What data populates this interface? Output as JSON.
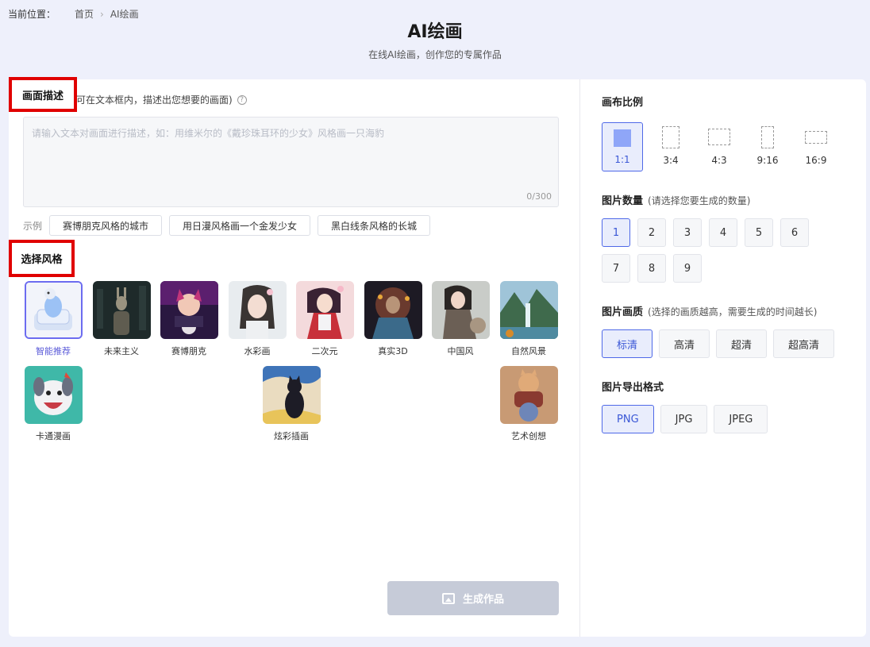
{
  "breadcrumb": {
    "label": "当前位置：",
    "home": "首页",
    "current": "AI绘画"
  },
  "header": {
    "title": "AI绘画",
    "subtitle": "在线AI绘画，创作您的专属作品"
  },
  "description": {
    "title": "画面描述",
    "hint": "可在文本框内，描述出您想要的画面)",
    "help_icon": "?",
    "placeholder": "请输入文本对画面进行描述，如：用维米尔的《戴珍珠耳环的少女》风格画一只海豹",
    "count": "0/300"
  },
  "examples": {
    "label": "示例",
    "items": [
      "赛博朋克风格的城市",
      "用日漫风格画一个金发少女",
      "黑白线条风格的长城"
    ]
  },
  "styles": {
    "title": "选择风格",
    "items": [
      {
        "name": "智能推荐"
      },
      {
        "name": "未来主义"
      },
      {
        "name": "赛博朋克"
      },
      {
        "name": "水彩画"
      },
      {
        "name": "二次元"
      },
      {
        "name": "真实3D"
      },
      {
        "name": "中国风"
      },
      {
        "name": "自然风景"
      },
      {
        "name": "卡通漫画"
      },
      {
        "name": "炫彩插画"
      },
      {
        "name": "艺术创想"
      }
    ]
  },
  "generate": {
    "label": "生成作品"
  },
  "ratio": {
    "title": "画布比例",
    "options": [
      "1:1",
      "3:4",
      "4:3",
      "9:16",
      "16:9"
    ],
    "selected": "1:1"
  },
  "count": {
    "title": "图片数量",
    "sub": "(请选择您要生成的数量)",
    "options": [
      "1",
      "2",
      "3",
      "4",
      "5",
      "6",
      "7",
      "8",
      "9"
    ],
    "selected": "1"
  },
  "quality": {
    "title": "图片画质",
    "sub": "(选择的画质越高，需要生成的时间越长)",
    "options": [
      "标清",
      "高清",
      "超清",
      "超高清"
    ],
    "selected": "标清"
  },
  "format": {
    "title": "图片导出格式",
    "options": [
      "PNG",
      "JPG",
      "JPEG"
    ],
    "selected": "PNG"
  }
}
